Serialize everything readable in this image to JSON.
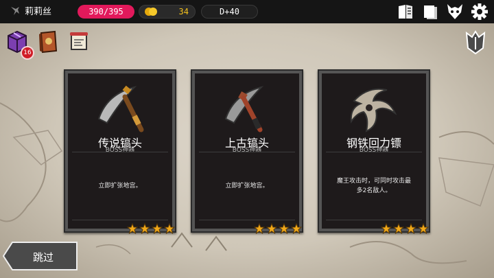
{
  "player": {
    "name": "莉莉丝"
  },
  "stats": {
    "hp": "390/395",
    "gold": "34",
    "day": "D+40"
  },
  "inventory_badge": "16",
  "cards": [
    {
      "title": "传说镐头",
      "subtitle": "BOSS神器",
      "description": "立即扩张地宫。",
      "stars": 4
    },
    {
      "title": "上古镐头",
      "subtitle": "BOSS神器",
      "description": "立即扩张地宫。",
      "stars": 4
    },
    {
      "title": "钢铁回力镖",
      "subtitle": "BOSS神器",
      "description": "魔王攻击时，可同时攻击最多2名敌人。",
      "stars": 4
    }
  ],
  "skip_label": "跳过",
  "colors": {
    "hp": "#e2195b",
    "gold": "#f4c21d",
    "topbar": "#151515",
    "card_bg": "#1e1a1b",
    "star": "#f0a81a"
  },
  "icons": [
    "dragon-emblem-icon",
    "gold-coin-icon",
    "quest-book-icon",
    "codex-icon",
    "demon-mask-icon",
    "gear-icon",
    "treasure-box-icon",
    "spellbook-icon",
    "scroll-map-icon",
    "winged-helmet-icon",
    "star-icon"
  ]
}
